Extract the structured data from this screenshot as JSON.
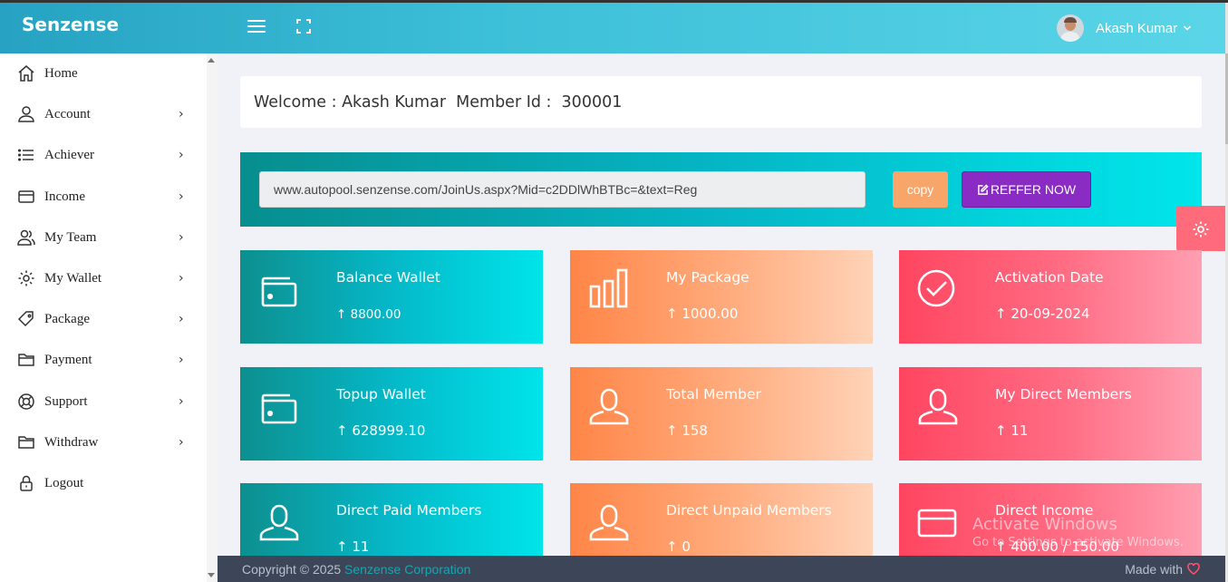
{
  "header": {
    "brand": "Senzense",
    "user_name": "Akash Kumar"
  },
  "sidebar": {
    "items": [
      {
        "label": "Home",
        "icon": "home-icon",
        "has_chevron": false
      },
      {
        "label": "Account",
        "icon": "user-icon",
        "has_chevron": true
      },
      {
        "label": "Achiever",
        "icon": "list-icon",
        "has_chevron": true
      },
      {
        "label": "Income",
        "icon": "card-icon",
        "has_chevron": true
      },
      {
        "label": "My Team",
        "icon": "team-icon",
        "has_chevron": true
      },
      {
        "label": "My Wallet",
        "icon": "gear-icon",
        "has_chevron": true
      },
      {
        "label": "Package",
        "icon": "tag-icon",
        "has_chevron": true
      },
      {
        "label": "Payment",
        "icon": "folder-icon",
        "has_chevron": true
      },
      {
        "label": "Support",
        "icon": "support-icon",
        "has_chevron": true
      },
      {
        "label": "Withdraw",
        "icon": "folder-icon",
        "has_chevron": true
      },
      {
        "label": "Logout",
        "icon": "lock-icon",
        "has_chevron": false
      }
    ]
  },
  "welcome": {
    "text": "Welcome : Akash Kumar  Member Id :  300001"
  },
  "referral": {
    "url": "www.autopool.senzense.com/JoinUs.aspx?Mid=c2DDlWhBTBc=&text=Reg",
    "copy_label": "copy",
    "reffer_label": "REFFER NOW"
  },
  "cards": [
    {
      "title": "Balance Wallet",
      "value": "↑ 8800.00",
      "theme": "teal",
      "icon": "wallet-icon"
    },
    {
      "title": "My Package",
      "value": "↑ 1000.00",
      "theme": "orange",
      "icon": "bar-chart-icon"
    },
    {
      "title": "Activation Date",
      "value": "↑ 20-09-2024",
      "theme": "pink",
      "icon": "check-circle-icon"
    },
    {
      "title": "Topup Wallet",
      "value": "↑ 628999.10",
      "theme": "teal",
      "icon": "wallet-icon"
    },
    {
      "title": "Total Member",
      "value": "↑ 158",
      "theme": "orange",
      "icon": "user-icon"
    },
    {
      "title": "My Direct Members",
      "value": "↑ 11",
      "theme": "pink",
      "icon": "user-icon"
    },
    {
      "title": "Direct Paid Members",
      "value": "↑ 11",
      "theme": "teal",
      "icon": "user-icon"
    },
    {
      "title": "Direct Unpaid Members",
      "value": "↑ 0",
      "theme": "orange",
      "icon": "user-icon"
    },
    {
      "title": "Direct Income",
      "value": "↑ 400.00 / 150.00",
      "theme": "pink",
      "icon": "credit-card-icon"
    }
  ],
  "watermark": {
    "line1": "Activate Windows",
    "line2": "Go to Settings to activate Windows."
  },
  "footer": {
    "copyright": "Copyright © 2025 ",
    "company": "Senzense Corporation",
    "made_with": "Made with"
  },
  "colors": {
    "header_start": "#27a2c2",
    "header_end": "#5ad5e8",
    "reffer_button": "#8a2bc4",
    "copy_button": "#f8a56a",
    "footer_bg": "#3c4658",
    "heart": "#ff4d6d"
  }
}
